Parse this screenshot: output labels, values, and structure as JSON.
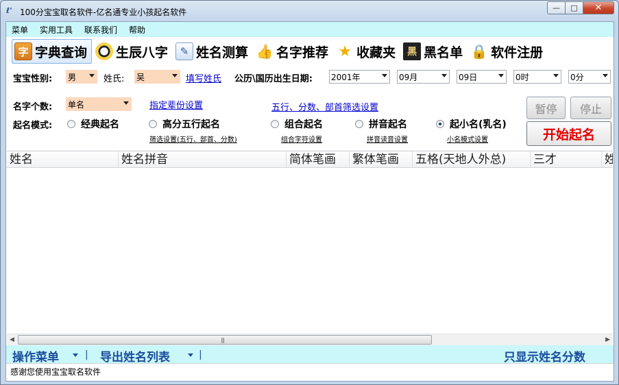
{
  "window": {
    "title": "100分宝宝取名软件-亿名通专业小孩起名软件",
    "min_label": "—",
    "max_label": "□",
    "close_label": "✕"
  },
  "menu": [
    "菜单",
    "实用工具",
    "联系我们",
    "帮助"
  ],
  "toolbar": [
    {
      "label": "字典查询",
      "icon": "dictionary-icon",
      "glyph": "字"
    },
    {
      "label": "生辰八字",
      "icon": "bagua-icon",
      "glyph": ""
    },
    {
      "label": "姓名测算",
      "icon": "measure-icon",
      "glyph": "✎"
    },
    {
      "label": "名字推荐",
      "icon": "thumbs-up-icon",
      "glyph": "👍"
    },
    {
      "label": "收藏夹",
      "icon": "star-icon",
      "glyph": "★"
    },
    {
      "label": "黑名单",
      "icon": "blacklist-icon",
      "glyph": "黑"
    },
    {
      "label": "软件注册",
      "icon": "lock-icon",
      "glyph": "🔒"
    }
  ],
  "form": {
    "gender_label": "宝宝性别:",
    "gender_value": "男",
    "surname_label": "姓氏:",
    "surname_value": "吴",
    "fill_surname_link": "填写姓氏",
    "birthdate_label": "公历\\国历出生日期:",
    "year": "2001年",
    "month": "09月",
    "day": "09日",
    "hour": "0时",
    "minute": "0分",
    "name_count_label": "名字个数:",
    "name_count_value": "单名",
    "generation_link": "指定辈份设置",
    "filter_link": "五行、分数、部首筛选设置",
    "mode_label": "起名模式:",
    "modes": [
      {
        "label": "经典起名",
        "checked": false,
        "sub": ""
      },
      {
        "label": "高分五行起名",
        "checked": false,
        "sub": "筛选设置(五行、部首、分数)"
      },
      {
        "label": "组合起名",
        "checked": false,
        "sub": "组合字符设置"
      },
      {
        "label": "拼音起名",
        "checked": false,
        "sub": "拼音读音设置"
      },
      {
        "label": "起小名(乳名)",
        "checked": true,
        "sub": "小名模式设置"
      }
    ],
    "pause_label": "暂停",
    "stop_label": "停止",
    "start_label": "开始起名"
  },
  "grid": {
    "columns": [
      "姓名",
      "姓名拼音",
      "简体笔画",
      "繁体笔画",
      "五格(天地人外总)",
      "三才",
      "姓"
    ]
  },
  "bottom": {
    "ops_menu": "操作菜单",
    "export_list": "导出姓名列表",
    "show_score": "只显示姓名分数",
    "separator": "|"
  },
  "status": "感谢您使用宝宝取名软件",
  "colors": {
    "menubar_bg": "#c9f7fa",
    "start_text": "#e00000",
    "link": "#0000cc",
    "bottom_text": "#1a4c9c"
  }
}
